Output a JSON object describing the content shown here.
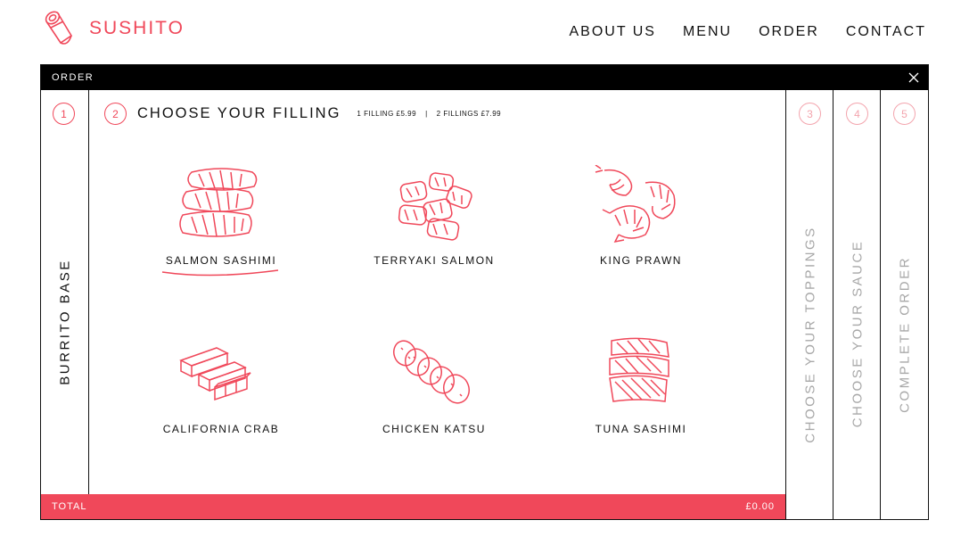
{
  "brand": {
    "name": "SUSHITO",
    "icon": "sushi-roll-icon"
  },
  "nav": [
    {
      "label": "ABOUT US"
    },
    {
      "label": "MENU"
    },
    {
      "label": "ORDER"
    },
    {
      "label": "CONTACT"
    }
  ],
  "order": {
    "title": "ORDER",
    "close_icon": "close-icon",
    "steps": [
      {
        "number": "1",
        "label": "BURRITO BASE"
      },
      {
        "number": "2",
        "label": "CHOOSE YOUR FILLING",
        "active": true
      },
      {
        "number": "3",
        "label": "CHOOSE YOUR TOPPINGS"
      },
      {
        "number": "4",
        "label": "CHOOSE YOUR SAUCE"
      },
      {
        "number": "5",
        "label": "COMPLETE ORDER"
      }
    ],
    "pricing": {
      "one": "1 FILLING £5.99",
      "separator": "|",
      "two": "2 FILLINGS £7.99"
    },
    "fillings": [
      {
        "label": "SALMON SASHIMI",
        "icon": "salmon-sashimi-icon",
        "selected": true
      },
      {
        "label": "TERRYAKI SALMON",
        "icon": "teriyaki-salmon-icon"
      },
      {
        "label": "KING PRAWN",
        "icon": "king-prawn-icon"
      },
      {
        "label": "CALIFORNIA CRAB",
        "icon": "crab-sticks-icon"
      },
      {
        "label": "CHICKEN KATSU",
        "icon": "chicken-katsu-icon"
      },
      {
        "label": "TUNA SASHIMI",
        "icon": "tuna-sashimi-icon"
      }
    ],
    "total_label": "TOTAL",
    "total_value": "£0.00"
  },
  "colors": {
    "accent": "#f0485a",
    "accent_light": "#f3a4ad",
    "frame": "#111111",
    "muted_text": "#a8a8a8"
  }
}
